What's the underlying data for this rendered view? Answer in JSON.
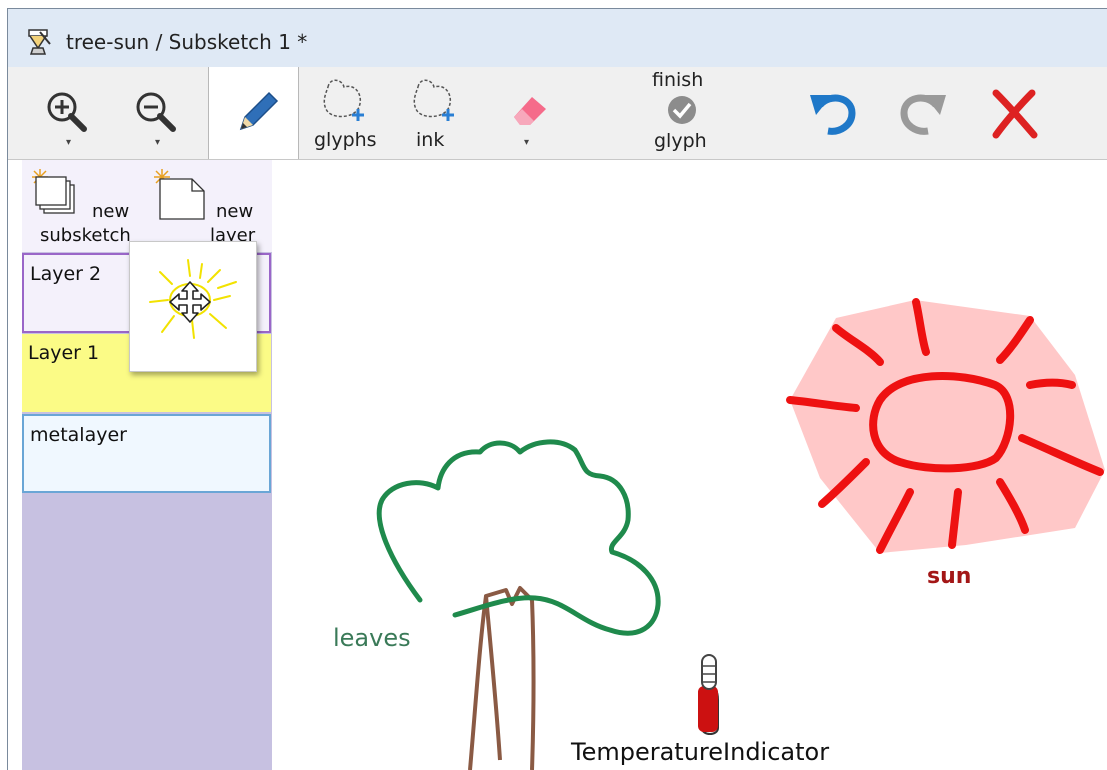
{
  "window": {
    "title": "tree-sun / Subsketch 1 *"
  },
  "toolbar": {
    "zoom_in_dropdown": "▾",
    "zoom_out_dropdown": "▾",
    "glyphs_label": "glyphs",
    "ink_label": "ink",
    "eraser_dropdown": "▾",
    "finish_label_top": "finish",
    "finish_label_bottom": "glyph"
  },
  "sidebar": {
    "new_subsketch_line1": "new",
    "new_subsketch_line2": "subsketch",
    "new_layer_line1": "new",
    "new_layer_line2": "layer",
    "layers": [
      {
        "label": "Layer 2"
      },
      {
        "label": "Layer 1"
      },
      {
        "label": "metalayer"
      }
    ]
  },
  "canvas": {
    "labels": {
      "sun": "sun",
      "leaves": "leaves",
      "temperature": "TemperatureIndicator"
    }
  },
  "colors": {
    "titlebar": "#dfe9f5",
    "toolbar": "#f0f0f0",
    "sidebar": "#c7c1e1",
    "layer1_highlight": "#fbfb86",
    "sun_ink": "#ee1111",
    "sun_fill": "#ffc8c8",
    "leaves_ink": "#1f8a4c",
    "trunk_ink": "#8a5a44",
    "undo_blue": "#1f78c8",
    "delete_red": "#dd2222"
  }
}
